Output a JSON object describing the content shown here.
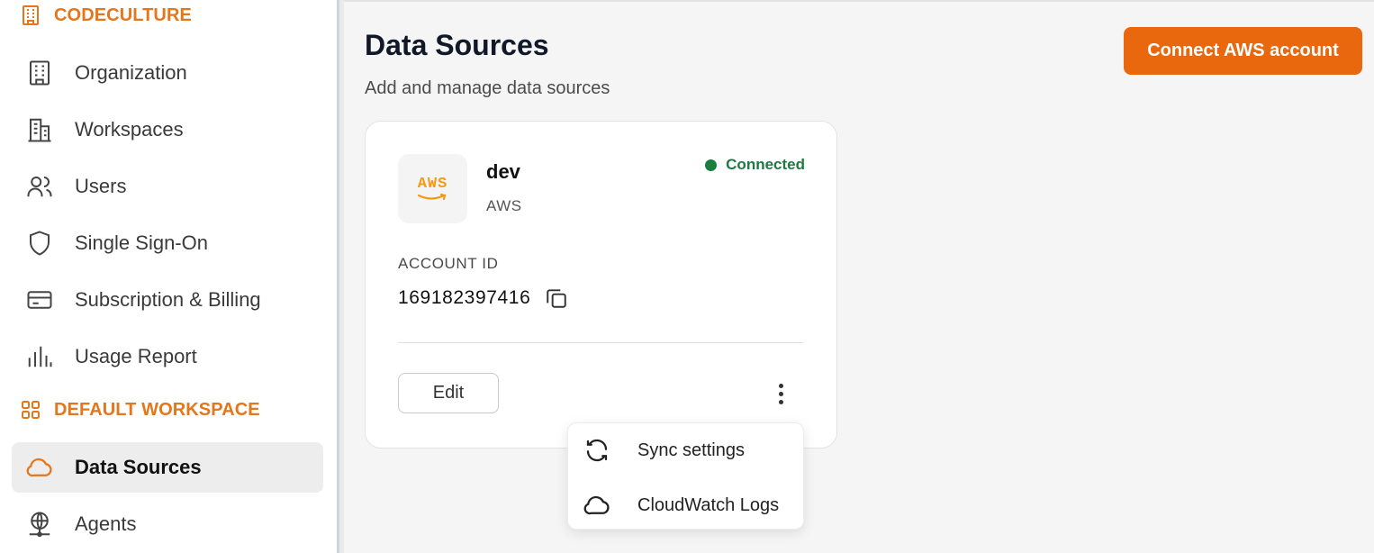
{
  "sidebar": {
    "org_section": {
      "title": "CODECULTURE",
      "icon": "building-icon"
    },
    "items": [
      {
        "label": "Organization",
        "icon": "building-icon"
      },
      {
        "label": "Workspaces",
        "icon": "buildings-icon"
      },
      {
        "label": "Users",
        "icon": "users-icon"
      },
      {
        "label": "Single Sign-On",
        "icon": "shield-icon"
      },
      {
        "label": "Subscription & Billing",
        "icon": "credit-card-icon"
      },
      {
        "label": "Usage Report",
        "icon": "bar-chart-icon"
      }
    ],
    "workspace_section": {
      "title": "DEFAULT WORKSPACE",
      "icon": "grid-icon"
    },
    "workspace_items": [
      {
        "label": "Data Sources",
        "icon": "cloud-icon",
        "active": true
      },
      {
        "label": "Agents",
        "icon": "globe-network-icon",
        "active": false
      }
    ]
  },
  "header": {
    "title": "Data Sources",
    "subtitle": "Add and manage data sources",
    "connect_button": "Connect AWS account"
  },
  "card": {
    "logo_text": "AWS",
    "name": "dev",
    "type": "AWS",
    "status": "Connected",
    "account_id_label": "ACCOUNT ID",
    "account_id": "169182397416",
    "edit_button": "Edit"
  },
  "menu": {
    "items": [
      {
        "label": "Sync settings",
        "icon": "sync-icon"
      },
      {
        "label": "CloudWatch Logs",
        "icon": "cloud-icon"
      }
    ]
  },
  "colors": {
    "accent": "#e9680d",
    "section_header": "#e4761b",
    "status_green": "#1a7f3e",
    "aws_orange": "#f39a14"
  }
}
